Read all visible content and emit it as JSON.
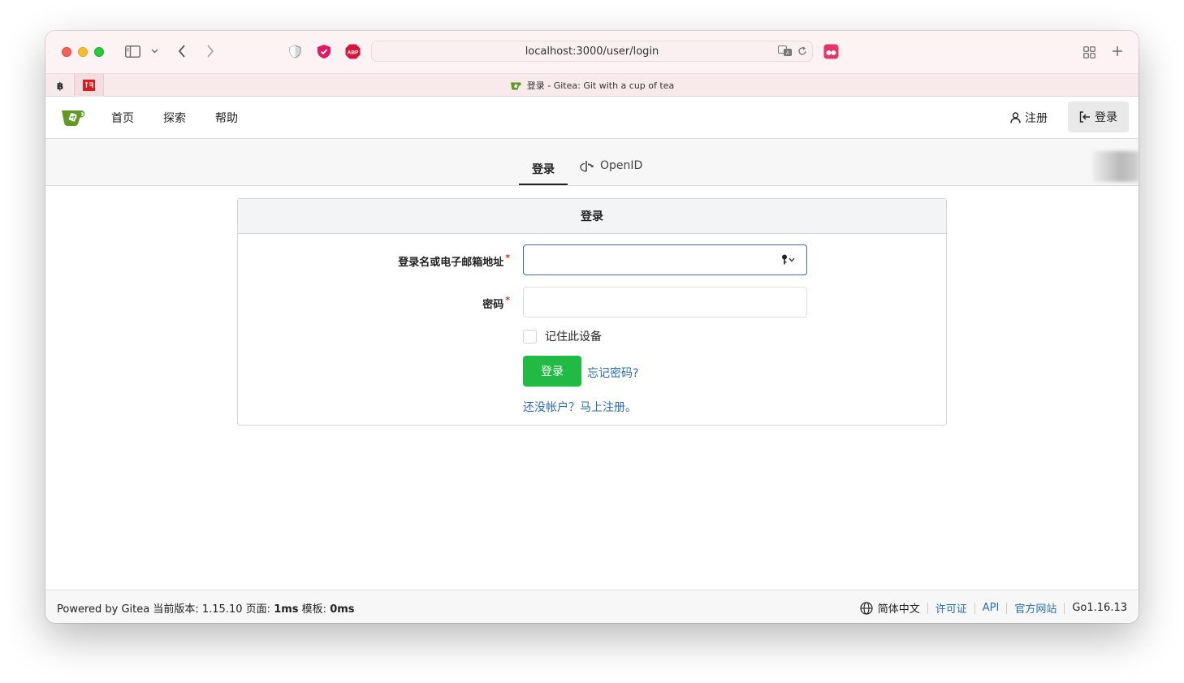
{
  "browser": {
    "url": "localhost:3000/user/login",
    "tab_title": "登录 - Gitea: Git with a cup of tea"
  },
  "nav": {
    "items": [
      "首页",
      "探索",
      "帮助"
    ],
    "register": "注册",
    "login": "登录"
  },
  "tabs": {
    "login": "登录",
    "openid": "OpenID"
  },
  "form": {
    "title": "登录",
    "username_label": "登录名或电子邮箱地址",
    "username_value": "",
    "password_label": "密码",
    "password_value": "",
    "required_mark": "*",
    "remember_label": "记住此设备",
    "remember_checked": false,
    "submit_label": "登录",
    "forgot_link": "忘记密码?",
    "signup_link": "还没帐户？马上注册。"
  },
  "footer": {
    "powered": "Powered by Gitea",
    "version_label": "当前版本: 1.15.10",
    "page_label": "页面:",
    "page_time": "1ms",
    "template_label": "模板:",
    "template_time": "0ms",
    "language": "简体中文",
    "license": "许可证",
    "api": "API",
    "website": "官方网站",
    "go_version": "Go1.16.13"
  },
  "colors": {
    "primary_button": "#21ba45",
    "link": "#2b6cb0",
    "brand": "#609926"
  }
}
